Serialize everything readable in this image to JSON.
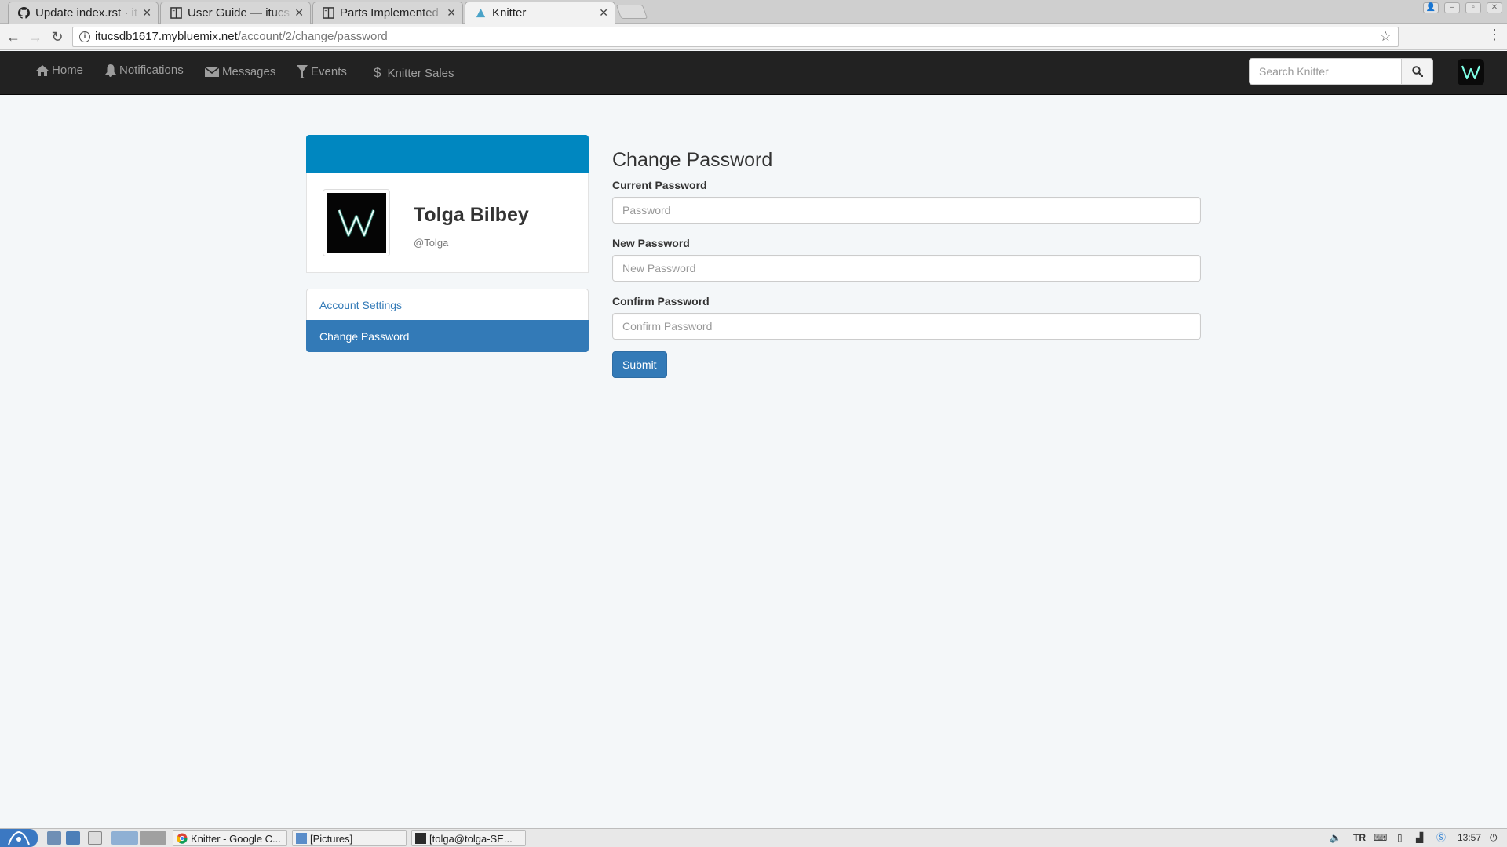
{
  "browser": {
    "tabs": [
      {
        "title": "Update index.rst · it",
        "icon": "github-icon"
      },
      {
        "title": "User Guide — itucs",
        "icon": "document-icon"
      },
      {
        "title": "Parts Implemented",
        "icon": "document-icon"
      },
      {
        "title": "Knitter",
        "icon": "knitter-icon",
        "active": true
      }
    ],
    "url_host": "itucsdb1617.mybluemix.net",
    "url_path": "/account/2/change/password"
  },
  "navbar": {
    "items": [
      {
        "label": "Home",
        "icon": "home-icon"
      },
      {
        "label": "Notifications",
        "icon": "bell-icon"
      },
      {
        "label": "Messages",
        "icon": "envelope-icon"
      },
      {
        "label": "Events",
        "icon": "glass-icon"
      },
      {
        "label": "Knitter Sales",
        "icon": "dollar-icon"
      }
    ],
    "search_placeholder": "Search Knitter"
  },
  "profile": {
    "name": "Tolga Bilbey",
    "handle": "@Tolga"
  },
  "sidebar": {
    "items": [
      {
        "label": "Account Settings",
        "active": false
      },
      {
        "label": "Change Password",
        "active": true
      }
    ]
  },
  "form": {
    "title": "Change Password",
    "fields": [
      {
        "label": "Current Password",
        "placeholder": "Password"
      },
      {
        "label": "New Password",
        "placeholder": "New Password"
      },
      {
        "label": "Confirm Password",
        "placeholder": "Confirm Password"
      }
    ],
    "submit_label": "Submit"
  },
  "taskbar": {
    "windows": [
      "Knitter - Google C...",
      "[Pictures]",
      "[tolga@tolga-SE..."
    ],
    "keyboard_layout": "TR",
    "clock": "13:57"
  },
  "colors": {
    "banner": "#0087c0",
    "primary": "#337ab7",
    "navbar": "#222222",
    "page_bg": "#f4f7f9"
  }
}
